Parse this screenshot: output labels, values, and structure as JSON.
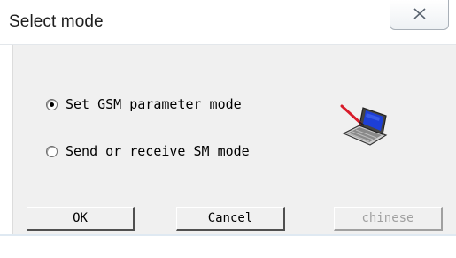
{
  "window": {
    "title": "Select mode",
    "close_icon": "close-icon"
  },
  "options": [
    {
      "label": "Set GSM parameter mode",
      "checked": true
    },
    {
      "label": "Send or receive SM mode",
      "checked": false
    }
  ],
  "illustration": {
    "icon": "laptop-icon"
  },
  "buttons": {
    "ok": "OK",
    "cancel": "Cancel",
    "chinese": "chinese"
  },
  "colors": {
    "dialog_background": "#f0f0f0",
    "laptop_screen": "#1d3fd6",
    "pen": "#d81b2a",
    "disabled_text": "#a0a0a0"
  }
}
